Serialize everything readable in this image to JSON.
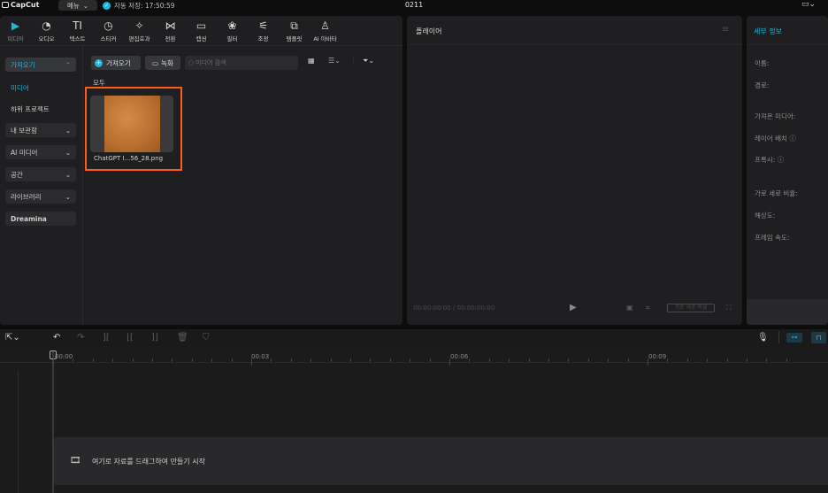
{
  "app": {
    "name": "CapCut",
    "menu_label": "메뉴",
    "autosave_text": "자동 저장: 17:50:59",
    "project_title": "0211"
  },
  "toolbar": {
    "items": [
      {
        "label": "미디어",
        "icon": "▶",
        "active": true
      },
      {
        "label": "오디오",
        "icon": "◔"
      },
      {
        "label": "텍스트",
        "icon": "TI"
      },
      {
        "label": "스티커",
        "icon": "◷"
      },
      {
        "label": "편집효과",
        "icon": "✧"
      },
      {
        "label": "전환",
        "icon": "⋈"
      },
      {
        "label": "캡션",
        "icon": "▭"
      },
      {
        "label": "필터",
        "icon": "❀"
      },
      {
        "label": "조정",
        "icon": "⚟"
      },
      {
        "label": "템플릿",
        "icon": "⧉"
      },
      {
        "label": "AI 아바타",
        "icon": "♙"
      }
    ]
  },
  "sidebar": {
    "import_label": "가져오기",
    "media_label": "미디어",
    "subproject_label": "하위 프로젝트",
    "my_storage_label": "내 보관함",
    "ai_media_label": "AI 미디어",
    "space_label": "공간",
    "library_label": "라이브러리",
    "dreamina_label": "Dreamina"
  },
  "media": {
    "import_button": "가져오기",
    "record_button": "녹화",
    "search_placeholder": "미디어 검색",
    "all_label": "모두",
    "file_name": "ChatGPT I...56_28.png"
  },
  "player": {
    "title": "플레이어",
    "timecode": "00:00:00:00 / 00:00:00:00",
    "ratio_label": "가로 세로 비율"
  },
  "details": {
    "title": "세부 정보",
    "labels": [
      "이름:",
      "경로:",
      "가져온 미디어:",
      "레이어 배치 ⓘ",
      "프록시: ⓘ",
      "가로 세로 비율:",
      "해상도:",
      "프레임 속도:"
    ]
  },
  "timeline": {
    "ruler_labels": [
      "00:00",
      "00:03",
      "00:06",
      "00:09"
    ],
    "drop_text": "여기로 자료를 드래그하여 만들기 시작"
  },
  "colors": {
    "accent": "#21b6d6",
    "highlight": "#ff5a1f",
    "panel": "#1f1f21"
  }
}
